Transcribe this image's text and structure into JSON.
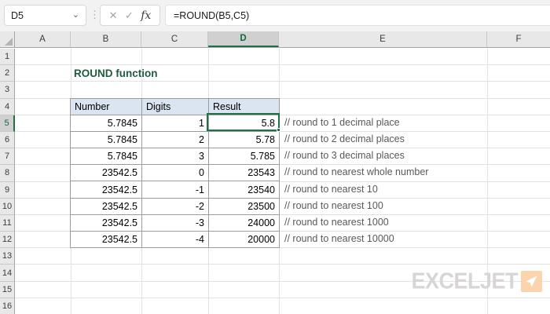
{
  "formula_bar": {
    "name_box": "D5",
    "formula": "=ROUND(B5,C5)"
  },
  "icons": {
    "dropdown": "⌄",
    "more": "⋮",
    "cancel": "✕",
    "enter": "✓",
    "fx": "fx"
  },
  "grid": {
    "columns": [
      "A",
      "B",
      "C",
      "D",
      "E",
      "F"
    ],
    "selected_column": "D",
    "selected_cell": "D5",
    "row_labels": [
      "1",
      "2",
      "3",
      "4",
      "5",
      "6",
      "7",
      "8",
      "9",
      "10",
      "11",
      "12",
      "13",
      "14",
      "15",
      "16"
    ],
    "selected_row": "5"
  },
  "sheet": {
    "title": "ROUND function",
    "table": {
      "headers": [
        "Number",
        "Digits",
        "Result"
      ],
      "rows": [
        {
          "number": "5.7845",
          "digits": "1",
          "result": "5.8",
          "comment": "// round to 1 decimal place"
        },
        {
          "number": "5.7845",
          "digits": "2",
          "result": "5.78",
          "comment": "// round to 2 decimal places"
        },
        {
          "number": "5.7845",
          "digits": "3",
          "result": "5.785",
          "comment": "// round to 3 decimal places"
        },
        {
          "number": "23542.5",
          "digits": "0",
          "result": "23543",
          "comment": "// round to nearest whole number"
        },
        {
          "number": "23542.5",
          "digits": "-1",
          "result": "23540",
          "comment": "// round to nearest 10"
        },
        {
          "number": "23542.5",
          "digits": "-2",
          "result": "23500",
          "comment": "// round to nearest 100"
        },
        {
          "number": "23542.5",
          "digits": "-3",
          "result": "24000",
          "comment": "// round to nearest 1000"
        },
        {
          "number": "23542.5",
          "digits": "-4",
          "result": "20000",
          "comment": "// round to nearest 10000"
        }
      ]
    }
  },
  "logo": {
    "text": "EXCELJET"
  },
  "colors": {
    "accent_green": "#1e7145",
    "selected_header_text": "#0f6b3c",
    "selected_header_bg": "#d0d0d0",
    "table_header_bg": "#dbe5f1",
    "title_green": "#1e5b41",
    "comment_gray": "#595959",
    "logo_gray": "#d8d5d5",
    "logo_orange": "#fbd3ad"
  }
}
